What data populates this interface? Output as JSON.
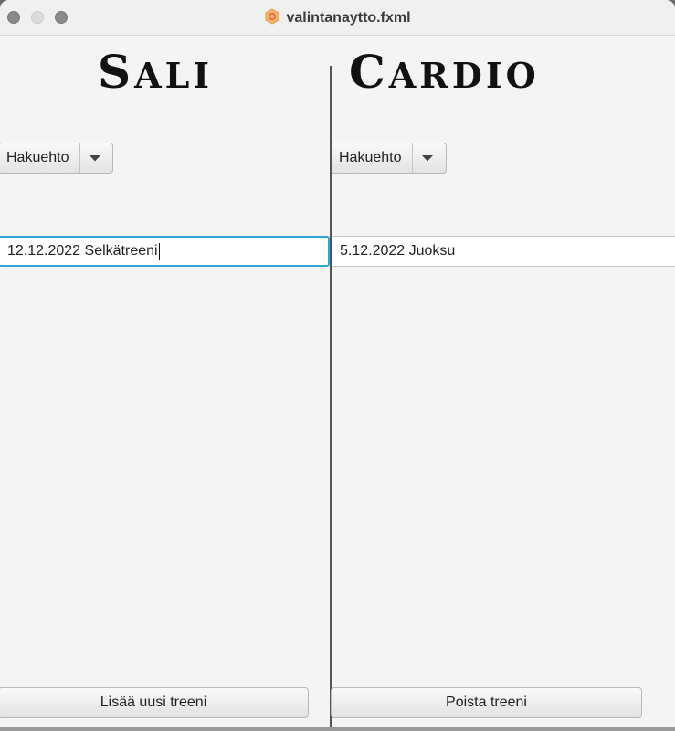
{
  "window": {
    "title": "valintanaytto.fxml",
    "accent_color": "#2fa8d6"
  },
  "left_panel": {
    "heading_first": "S",
    "heading_rest": "ali",
    "combo_label": "Hakuehto",
    "list_items": [
      "12.12.2022 Selkätreeni"
    ],
    "action_button": "Lisää uusi treeni"
  },
  "right_panel": {
    "heading_first": "C",
    "heading_rest": "ardio",
    "combo_label": "Hakuehto",
    "list_items": [
      "5.12.2022 Juoksu"
    ],
    "action_button": "Poista treeni"
  },
  "icons": {
    "app": "javafx-app-icon",
    "dropdown": "chevron-down-icon"
  }
}
